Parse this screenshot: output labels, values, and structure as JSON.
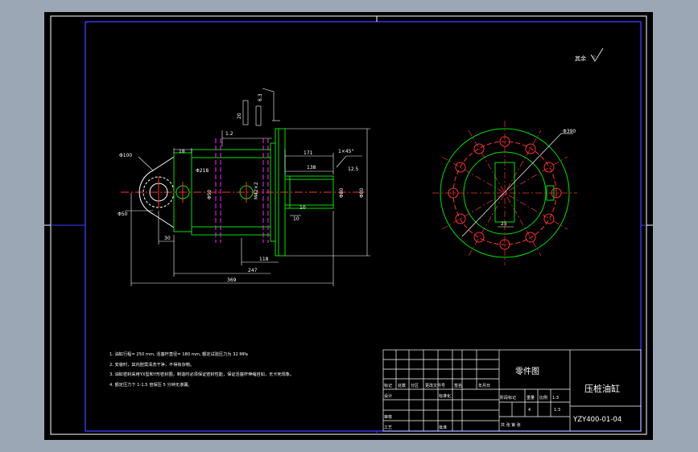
{
  "drawing": {
    "roughness_symbol": "其余",
    "notes": [
      "1. 油缸行程= 250 mm, 活塞杆直径= 180 mm, 额定试验压力为 32 MPa",
      "2. 安装时，其内腔需清洗干净，不得有杂物。",
      "3. 油缸密封采用YX型和Y形密封圈，制造时必须保证密封性能，保证活塞杆伸缩自如，无卡死现象。",
      "4. 额定压力下 1-1.5 倍保压 5 分钟无渗漏。"
    ],
    "dimensions": {
      "d_clevis": "Φ100",
      "d_pin": "Φ50",
      "d_barrel": "Φ218",
      "thread_bore": "M42×2",
      "d_rod": "Φ80",
      "d_flange_pcd": "Φ390",
      "len_head": "18",
      "len_clevis": "30",
      "len_flange": "118",
      "len_body": "247",
      "len_total": "369",
      "len_rod": "171",
      "len_rod2": "138",
      "len_small": "10",
      "len_small2": "10",
      "d_rod_end": "Φ50",
      "d_rod_tip": "Φ80",
      "tol_a": "1.2",
      "tol_b": "20",
      "tol_c": "12.5",
      "tol_d": "6.3",
      "chamfer": "1×45°",
      "slot": "25"
    }
  },
  "title_block": {
    "drawing_type": "零件图",
    "part_name": "压桩油缸",
    "drawing_no": "YZY400-01-04",
    "rev_headers": [
      "标记",
      "处数",
      "分区",
      "更改文件号",
      "签名",
      "年月日"
    ],
    "row_labels": [
      "设计",
      "标准化",
      "审核",
      "工艺",
      "批准"
    ],
    "stage_label": "阶段标记",
    "weight_label": "重量",
    "scale_label": "比例",
    "scale_value": "1:3",
    "weight_value": "4",
    "sheet_text": "共  张  第  张"
  }
}
